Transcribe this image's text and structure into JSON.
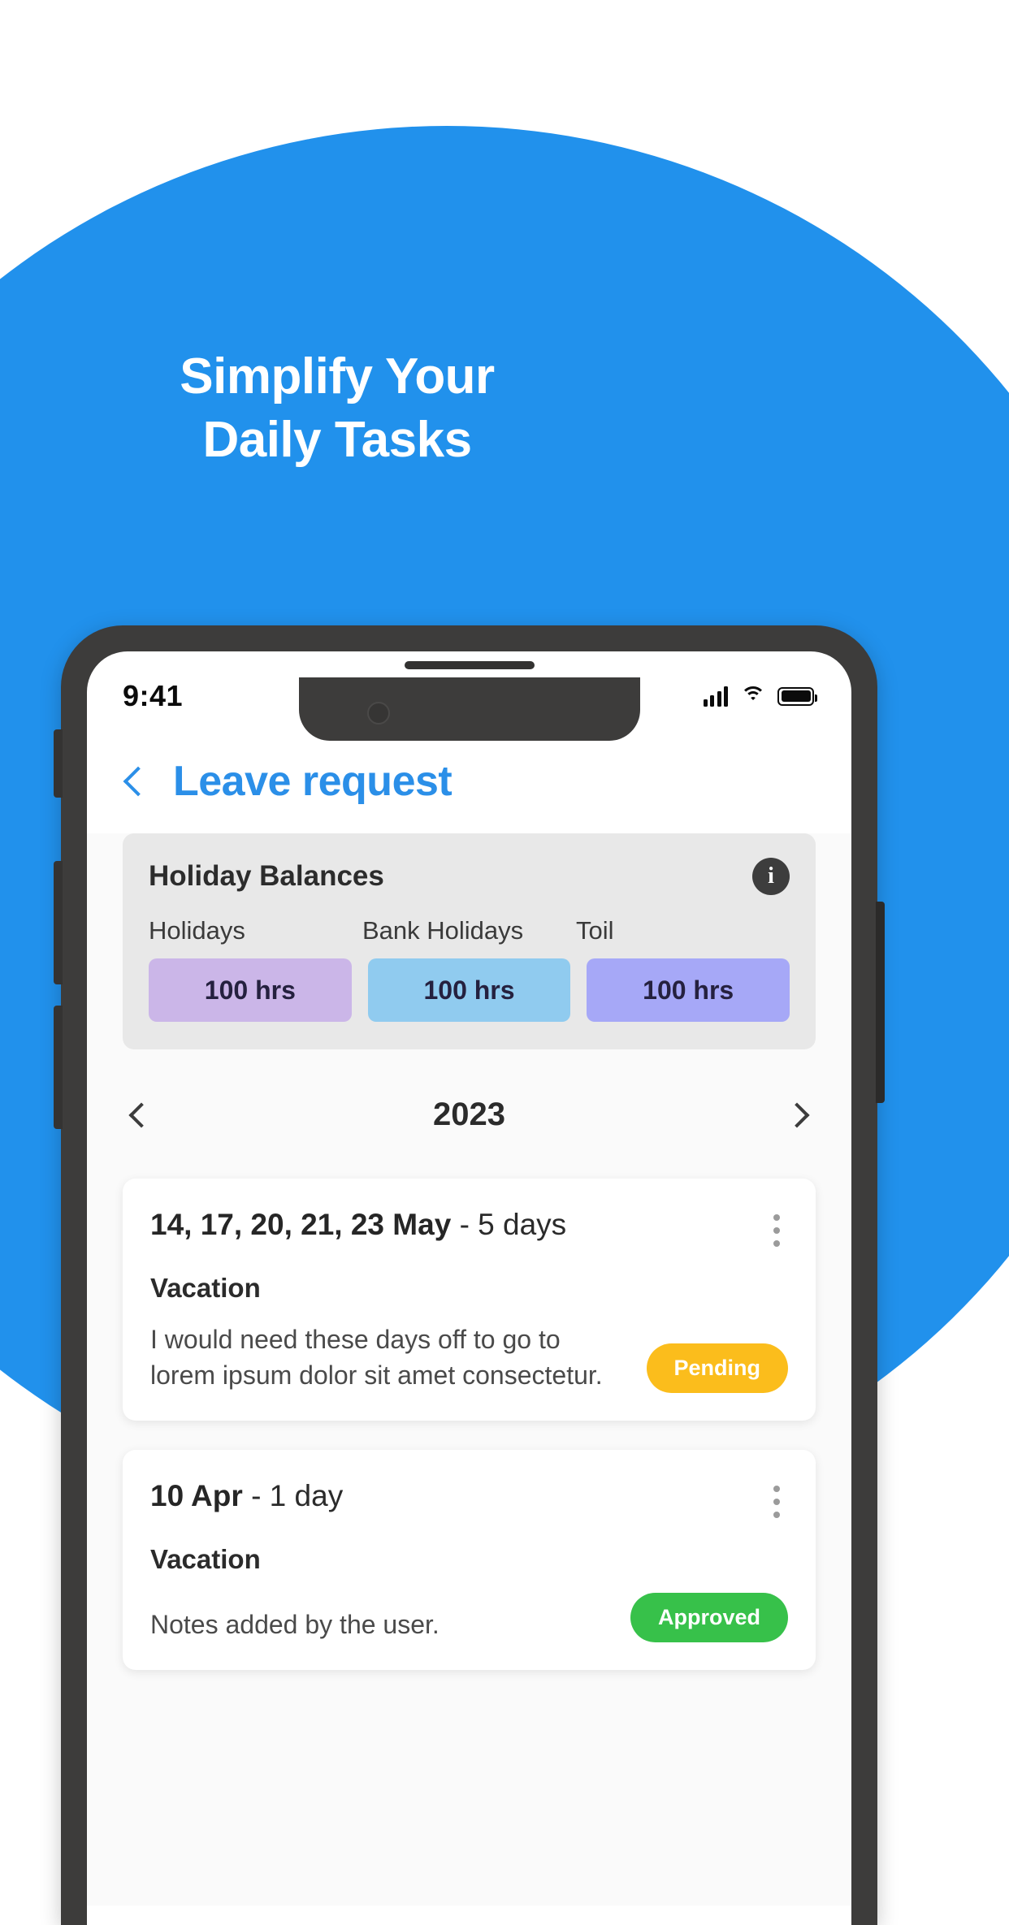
{
  "hero": {
    "headline_line1": "Simplify Your",
    "headline_line2": "Daily Tasks",
    "background_color": "#2191ec"
  },
  "status_bar": {
    "time": "9:41",
    "signal_icon": "cellular-signal-icon",
    "wifi_icon": "wifi-icon",
    "battery_icon": "battery-full-icon"
  },
  "app_header": {
    "back_icon": "chevron-left-icon",
    "title": "Leave request",
    "title_color": "#2b8fe8"
  },
  "balances": {
    "title": "Holiday Balances",
    "info_icon": "info-icon",
    "info_glyph": "i",
    "items": [
      {
        "label": "Holidays",
        "value": "100 hrs",
        "color": "#cbb6e8"
      },
      {
        "label": "Bank Holidays",
        "value": "100 hrs",
        "color": "#90cbef"
      },
      {
        "label": "Toil",
        "value": "100 hrs",
        "color": "#a6a8f7"
      }
    ]
  },
  "year_nav": {
    "prev_icon": "chevron-left-icon",
    "year": "2023",
    "next_icon": "chevron-right-icon"
  },
  "requests": [
    {
      "date": "14, 17, 20, 21, 23 May",
      "duration": "- 5 days",
      "type": "Vacation",
      "notes": "I would need these days off to go to lorem ipsum dolor sit amet consectetur.",
      "status": "Pending",
      "status_color": "#fbbd1c",
      "menu_icon": "kebab-menu-icon"
    },
    {
      "date": "10 Apr",
      "duration": "- 1 day",
      "type": "Vacation",
      "notes": "Notes added by the user.",
      "status": "Approved",
      "status_color": "#37c14a",
      "menu_icon": "kebab-menu-icon"
    }
  ]
}
